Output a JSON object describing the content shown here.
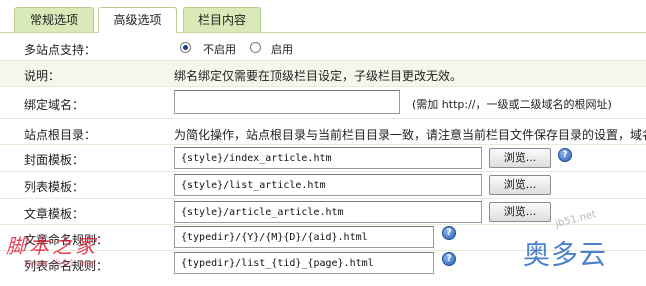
{
  "tabs": [
    {
      "label": "常规选项"
    },
    {
      "label": "高级选项"
    },
    {
      "label": "栏目内容"
    }
  ],
  "multisite": {
    "label": "多站点支持：",
    "option_off": "不启用",
    "option_on": "启用",
    "selected": "不启用"
  },
  "explain": {
    "label": "说明：",
    "text": "绑名绑定仅需要在顶级栏目设定，子级栏目更改无效。"
  },
  "domain": {
    "label": "绑定域名：",
    "value": "",
    "hint": "(需加 http://，一级或二级域名的根网址)"
  },
  "root": {
    "label": "站点根目录：",
    "text": "为简化操作，站点根目录与当前栏目目录一致，请注意当前栏目文件保存目录的设置，域名"
  },
  "cover_template": {
    "label": "封面模板：",
    "value": "{style}/index_article.htm",
    "button": "浏览..."
  },
  "list_template": {
    "label": "列表模板：",
    "value": "{style}/list_article.htm",
    "button": "浏览..."
  },
  "article_template": {
    "label": "文章模板：",
    "value": "{style}/article_article.htm",
    "button": "浏览..."
  },
  "article_rule": {
    "label": "文章命名规则：",
    "value": "{typedir}/{Y}/{M}{D}/{aid}.html"
  },
  "list_rule": {
    "label": "列表命名规则：",
    "value": "{typedir}/list_{tid}_{page}.html"
  },
  "icons": {
    "help": "help-question-icon",
    "help_glyph": "?"
  },
  "watermarks": {
    "left": "脚本之家",
    "left_url": "www.jb51.net",
    "right": "奥多云",
    "site": "jb51.net"
  },
  "colors": {
    "tab_bg": "#d9e9b8",
    "row_shade": "#f4f8ea",
    "help_blue": "#2a5fb5"
  }
}
